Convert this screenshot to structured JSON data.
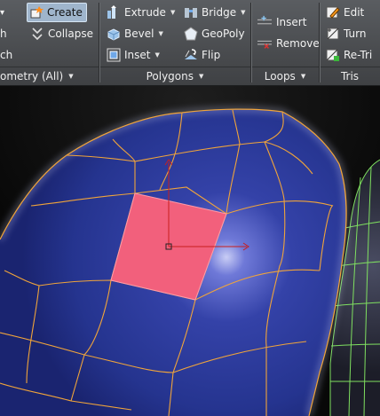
{
  "ribbon": {
    "geometry": {
      "create_label": "Create",
      "collapse_label": "Collapse",
      "fragment_label": "h",
      "fragment2_label": "ch",
      "group_label": "ometry (All)"
    },
    "polygons": {
      "extrude_label": "Extrude",
      "bevel_label": "Bevel",
      "inset_label": "Inset",
      "bridge_label": "Bridge",
      "geopoly_label": "GeoPoly",
      "flip_label": "Flip",
      "group_label": "Polygons"
    },
    "loops": {
      "insert_label": "Insert",
      "remove_label": "Remove",
      "group_label": "Loops"
    },
    "tris": {
      "edit_label": "Edit",
      "turn_label": "Turn",
      "retri_label": "Re-Tri",
      "group_label": "Tris"
    }
  },
  "icons": [
    "create-icon",
    "collapse-icon",
    "extrude-icon",
    "bevel-icon",
    "inset-icon",
    "bridge-icon",
    "geopoly-icon",
    "flip-icon",
    "insert-icon",
    "remove-icon",
    "edit-icon",
    "turn-icon",
    "retri-icon"
  ],
  "colors": {
    "ribbon_bg": "#4a4c4f",
    "mesh_blue": "#2a3aa0",
    "selected_face": "#f2607c",
    "wire_orange": "#f0a43a",
    "wire_green": "#7fe060",
    "gizmo_red": "#c81e1e"
  }
}
